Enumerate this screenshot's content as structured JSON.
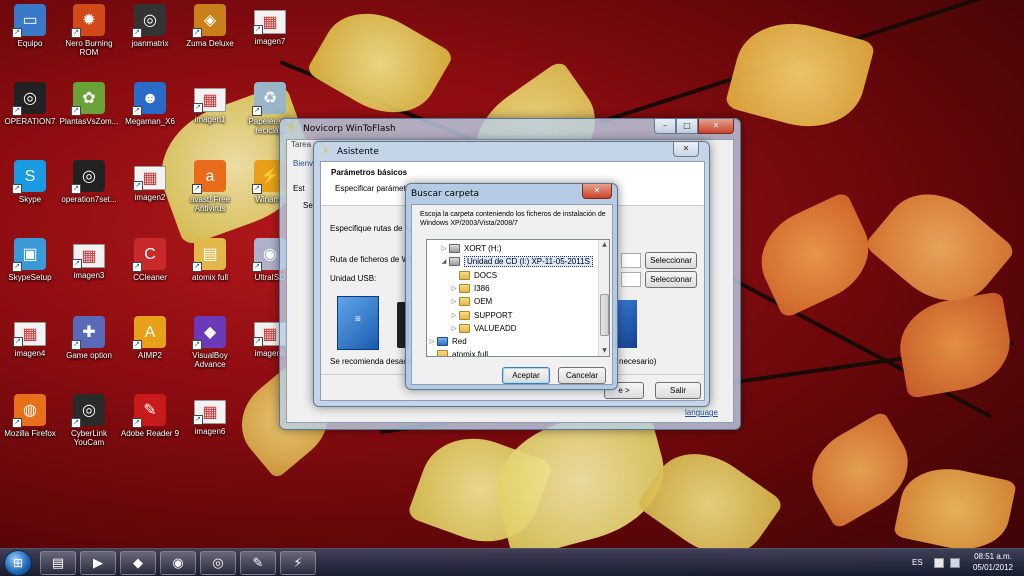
{
  "desktop": {
    "icons": [
      {
        "label": "Equipo",
        "icon": "computer-icon",
        "color": "#3a78c8"
      },
      {
        "label": "Nero Burning ROM",
        "icon": "nero-flame-icon",
        "color": "#d24a1a"
      },
      {
        "label": "joanmatrix",
        "icon": "app-icon",
        "color": "#333333"
      },
      {
        "label": "Zuma Deluxe",
        "icon": "zuma-icon",
        "color": "#c8801a"
      },
      {
        "label": "imagen7",
        "icon": "image-file-icon",
        "color": "#f2f2f2"
      },
      {
        "label": "OPERATION7",
        "icon": "operation7-icon",
        "color": "#222222"
      },
      {
        "label": "PlantasVsZom...",
        "icon": "plants-vs-zombies-icon",
        "color": "#6aa23a"
      },
      {
        "label": "Megaman_X6",
        "icon": "megaman-icon",
        "color": "#2a6ac8"
      },
      {
        "label": "imagen1",
        "icon": "image-file-icon",
        "color": "#f2f2f2"
      },
      {
        "label": "Papelera de reciclaje",
        "icon": "recycle-bin-icon",
        "color": "#9ab4c8"
      },
      {
        "label": "Skype",
        "icon": "skype-icon",
        "color": "#1a9ae0"
      },
      {
        "label": "operation7set...",
        "icon": "operation7-icon",
        "color": "#222222"
      },
      {
        "label": "imagen2",
        "icon": "image-file-icon",
        "color": "#f2f2f2"
      },
      {
        "label": "avast! Free Antivirus",
        "icon": "avast-icon",
        "color": "#e86a1a"
      },
      {
        "label": "Winamp",
        "icon": "winamp-icon",
        "color": "#e8a01a"
      },
      {
        "label": "SkypeSetup",
        "icon": "installer-icon",
        "color": "#3a9ad8"
      },
      {
        "label": "imagen3",
        "icon": "image-file-icon",
        "color": "#f2f2f2"
      },
      {
        "label": "CCleaner",
        "icon": "ccleaner-icon",
        "color": "#c82a2a"
      },
      {
        "label": "atomix full",
        "icon": "folder-icon",
        "color": "#e2b84a"
      },
      {
        "label": "UltraISO",
        "icon": "disc-icon",
        "color": "#b0b0c8"
      },
      {
        "label": "imagen4",
        "icon": "image-file-icon",
        "color": "#f2f2f2"
      },
      {
        "label": "Game option",
        "icon": "gamepad-icon",
        "color": "#5a6ab8"
      },
      {
        "label": "AIMP2",
        "icon": "aimp-icon",
        "color": "#e8a01a"
      },
      {
        "label": "VisualBoy Advance",
        "icon": "gameboy-icon",
        "color": "#6a3ab8"
      },
      {
        "label": "imagen5",
        "icon": "image-file-icon",
        "color": "#f2f2f2"
      },
      {
        "label": "Mozilla Firefox",
        "icon": "firefox-icon",
        "color": "#e8701a"
      },
      {
        "label": "CyberLink YouCam",
        "icon": "webcam-icon",
        "color": "#2a2a2a"
      },
      {
        "label": "Adobe Reader 9",
        "icon": "pdf-icon",
        "color": "#c81a1a"
      },
      {
        "label": "imagen6",
        "icon": "image-file-icon",
        "color": "#f2f2f2"
      }
    ]
  },
  "wintoflash": {
    "title": "Novicorp WinToFlash",
    "tab_fragment": "Tarea",
    "welcome_fragment": "Bienv",
    "side_fragment1": "Est",
    "side_fragment2": "Se",
    "language_link": "language"
  },
  "wizard": {
    "title": "Asistente",
    "heading": "Parámetros básicos",
    "subheading": "Especificar parámetros b",
    "paths_label": "Especifique rutas de fiche",
    "source_label": "Ruta de ficheros de Wind",
    "usb_label": "Unidad USB:",
    "select1": "Seleccionar",
    "select2": "Seleccionar",
    "recommend_text": "Se recomienda desactiva",
    "recommend_tail": "necesario)",
    "next_button": "e >",
    "exit_button": "Salir"
  },
  "folder_dialog": {
    "title": "Buscar carpeta",
    "instructions": "Escoja la carpeta conteniendo los ficheros de instalación de Windows XP/2003/Vista/2008/7",
    "tree": [
      {
        "label": "XORT (H:)",
        "type": "drive",
        "indent": 0,
        "arrow": "▷",
        "selected": false
      },
      {
        "label": "Unidad de CD (I:) XP-11-05-2011S",
        "type": "drive",
        "indent": 0,
        "arrow": "◢",
        "selected": true
      },
      {
        "label": "DOCS",
        "type": "folder",
        "indent": 1,
        "arrow": "",
        "selected": false
      },
      {
        "label": "I386",
        "type": "folder",
        "indent": 1,
        "arrow": "▷",
        "selected": false
      },
      {
        "label": "OEM",
        "type": "folder",
        "indent": 1,
        "arrow": "▷",
        "selected": false
      },
      {
        "label": "SUPPORT",
        "type": "folder",
        "indent": 1,
        "arrow": "▷",
        "selected": false
      },
      {
        "label": "VALUEADD",
        "type": "folder",
        "indent": 1,
        "arrow": "▷",
        "selected": false
      },
      {
        "label": "Red",
        "type": "network",
        "indent": -1,
        "arrow": "▷",
        "selected": false
      },
      {
        "label": "atomix full",
        "type": "folder",
        "indent": -1,
        "arrow": "",
        "selected": false
      }
    ],
    "accept": "Aceptar",
    "cancel": "Cancelar"
  },
  "taskbar": {
    "buttons": [
      {
        "icon": "explorer-folder-icon",
        "glyph": "▤"
      },
      {
        "icon": "media-player-icon",
        "glyph": "▶"
      },
      {
        "icon": "gameboy-icon",
        "glyph": "◆"
      },
      {
        "icon": "firefox-icon",
        "glyph": "◉"
      },
      {
        "icon": "operation7-icon",
        "glyph": "◎"
      },
      {
        "icon": "paint-icon",
        "glyph": "✎"
      },
      {
        "icon": "wintoflash-icon",
        "glyph": "⚡"
      }
    ],
    "language": "ES",
    "time": "08:51 a.m.",
    "date": "05/01/2012"
  }
}
